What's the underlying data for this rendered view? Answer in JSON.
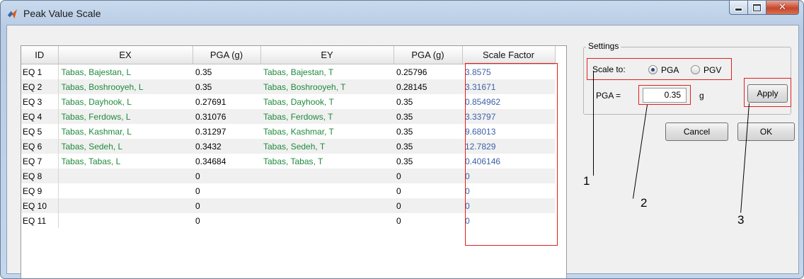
{
  "window": {
    "title": "Peak Value Scale",
    "icon": "matlab-icon",
    "controls": [
      "minimize-icon",
      "maximize-icon",
      "close-icon"
    ]
  },
  "table": {
    "headers": [
      "ID",
      "EX",
      "PGA (g)",
      "EY",
      "PGA (g)",
      "Scale Factor"
    ],
    "rows": [
      {
        "id": "EQ 1",
        "ex": "Tabas, Bajestan, L",
        "pga_x": "0.35",
        "ey": "Tabas, Bajestan, T",
        "pga_y": "0.25796",
        "scale": "3.8575"
      },
      {
        "id": "EQ 2",
        "ex": "Tabas, Boshrooyeh, L",
        "pga_x": "0.35",
        "ey": "Tabas, Boshrooyeh, T",
        "pga_y": "0.28145",
        "scale": "3.31671"
      },
      {
        "id": "EQ 3",
        "ex": "Tabas, Dayhook, L",
        "pga_x": "0.27691",
        "ey": "Tabas, Dayhook, T",
        "pga_y": "0.35",
        "scale": "0.854962"
      },
      {
        "id": "EQ 4",
        "ex": "Tabas, Ferdows, L",
        "pga_x": "0.31076",
        "ey": "Tabas, Ferdows, T",
        "pga_y": "0.35",
        "scale": "3.33797"
      },
      {
        "id": "EQ 5",
        "ex": "Tabas, Kashmar, L",
        "pga_x": "0.31297",
        "ey": "Tabas, Kashmar, T",
        "pga_y": "0.35",
        "scale": "9.68013"
      },
      {
        "id": "EQ 6",
        "ex": "Tabas, Sedeh, L",
        "pga_x": "0.3432",
        "ey": "Tabas, Sedeh, T",
        "pga_y": "0.35",
        "scale": "12.7829"
      },
      {
        "id": "EQ 7",
        "ex": "Tabas, Tabas, L",
        "pga_x": "0.34684",
        "ey": "Tabas, Tabas, T",
        "pga_y": "0.35",
        "scale": "0.406146"
      },
      {
        "id": "EQ 8",
        "ex": "",
        "pga_x": "0",
        "ey": "",
        "pga_y": "0",
        "scale": "0"
      },
      {
        "id": "EQ 9",
        "ex": "",
        "pga_x": "0",
        "ey": "",
        "pga_y": "0",
        "scale": "0"
      },
      {
        "id": "EQ 10",
        "ex": "",
        "pga_x": "0",
        "ey": "",
        "pga_y": "0",
        "scale": "0"
      },
      {
        "id": "EQ 11",
        "ex": "",
        "pga_x": "0",
        "ey": "",
        "pga_y": "0",
        "scale": "0"
      }
    ]
  },
  "settings": {
    "group_label": "Settings",
    "scale_to_label": "Scale to:",
    "options": [
      {
        "label": "PGA",
        "selected": true
      },
      {
        "label": "PGV",
        "selected": false
      }
    ],
    "value_label": "PGA =",
    "value": "0.35",
    "unit": "g",
    "apply_label": "Apply",
    "cancel_label": "Cancel",
    "ok_label": "OK"
  },
  "callouts": [
    "1",
    "2",
    "3"
  ],
  "colors": {
    "highlight": "#e02020",
    "record_name": "#1f8a3c",
    "scale_factor": "#3e61a8"
  }
}
